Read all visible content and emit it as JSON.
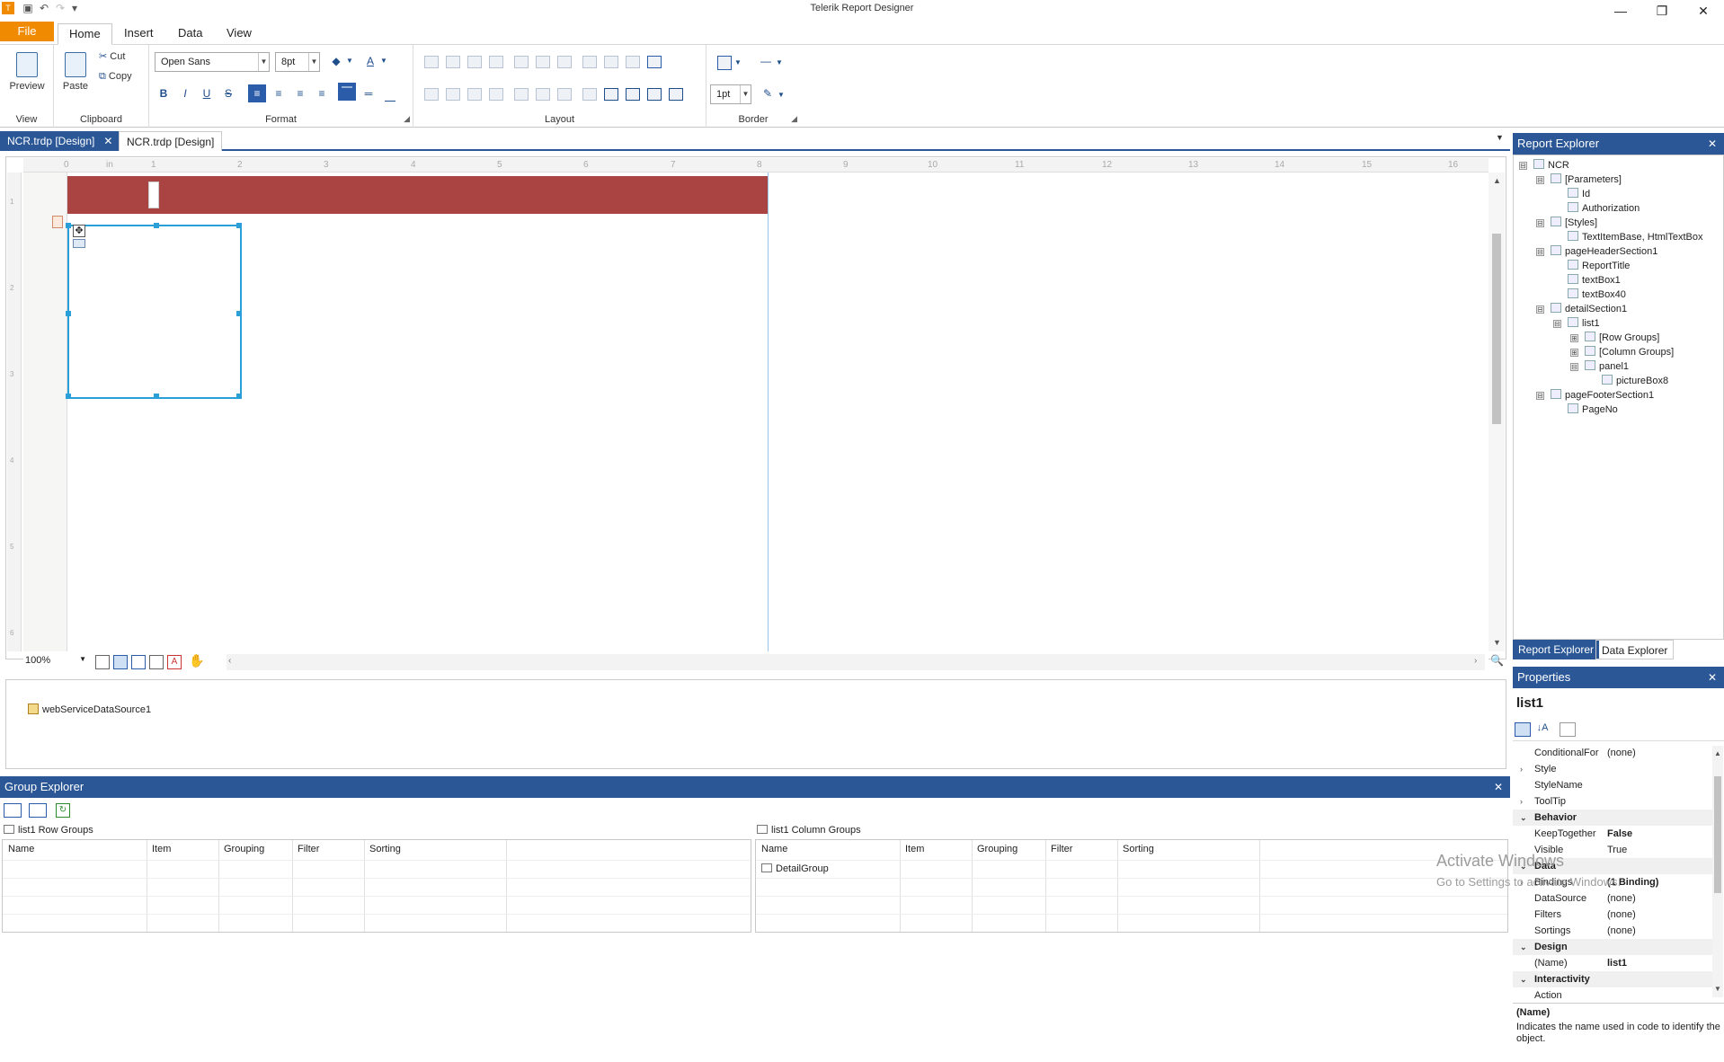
{
  "app": {
    "title": "Telerik Report Designer"
  },
  "window_controls": {
    "minimize": "—",
    "restore": "❐",
    "close": "✕"
  },
  "menu": {
    "file": "File",
    "home": "Home",
    "insert": "Insert",
    "data": "Data",
    "view": "View"
  },
  "ribbon": {
    "view_group": {
      "label": "View",
      "preview": "Preview"
    },
    "clipboard_group": {
      "label": "Clipboard",
      "paste": "Paste",
      "cut": "Cut",
      "copy": "Copy"
    },
    "format_group": {
      "label": "Format",
      "font": "Open Sans",
      "size": "8pt",
      "bold": "B",
      "italic": "I",
      "underline": "U",
      "strike": "S"
    },
    "layout_group": {
      "label": "Layout"
    },
    "border_group": {
      "label": "Border",
      "width": "1pt"
    }
  },
  "doc_tabs": [
    {
      "label": "NCR.trdp [Design]",
      "close": "✕"
    },
    {
      "label": "NCR.trdp [Design]"
    }
  ],
  "ruler": {
    "unit": "in",
    "h_ticks": [
      "0",
      "1",
      "2",
      "3",
      "4",
      "5",
      "6",
      "7",
      "8",
      "9",
      "10",
      "11",
      "12",
      "13",
      "14",
      "15",
      "16"
    ],
    "v_ticks": [
      "1",
      "2",
      "3",
      "4",
      "5",
      "6"
    ]
  },
  "zoom": {
    "value": "100%"
  },
  "datasources": [
    {
      "name": "webServiceDataSource1"
    }
  ],
  "group_explorer": {
    "title": "Group Explorer",
    "close": "✕",
    "row_groups": {
      "title": "list1 Row Groups",
      "columns": [
        "Name",
        "Item",
        "Grouping",
        "Filter",
        "Sorting"
      ],
      "rows": []
    },
    "column_groups": {
      "title": "list1 Column Groups",
      "columns": [
        "Name",
        "Item",
        "Grouping",
        "Filter",
        "Sorting"
      ],
      "rows": [
        {
          "name": "DetailGroup"
        }
      ]
    }
  },
  "report_explorer": {
    "title": "Report Explorer",
    "close": "✕",
    "tree": [
      {
        "label": "NCR",
        "level": 0,
        "expander": "⊟",
        "icon": "report-icon"
      },
      {
        "label": "[Parameters]",
        "level": 1,
        "expander": "⊟",
        "icon": "parameters-icon"
      },
      {
        "label": "Id",
        "level": 2,
        "expander": "",
        "icon": "textbox-icon"
      },
      {
        "label": "Authorization",
        "level": 2,
        "expander": "",
        "icon": "textbox-icon"
      },
      {
        "label": "[Styles]",
        "level": 1,
        "expander": "⊟",
        "icon": "styles-icon"
      },
      {
        "label": "TextItemBase, HtmlTextBox",
        "level": 2,
        "expander": "",
        "icon": "style-icon"
      },
      {
        "label": "pageHeaderSection1",
        "level": 1,
        "expander": "⊟",
        "icon": "section-icon"
      },
      {
        "label": "ReportTitle",
        "level": 2,
        "expander": "",
        "icon": "textbox-icon"
      },
      {
        "label": "textBox1",
        "level": 2,
        "expander": "",
        "icon": "textbox-icon"
      },
      {
        "label": "textBox40",
        "level": 2,
        "expander": "",
        "icon": "textbox-icon"
      },
      {
        "label": "detailSection1",
        "level": 1,
        "expander": "⊟",
        "icon": "section-icon"
      },
      {
        "label": "list1",
        "level": 2,
        "expander": "⊟",
        "icon": "list-icon"
      },
      {
        "label": "[Row Groups]",
        "level": 3,
        "expander": "⊞",
        "icon": "row-groups-icon"
      },
      {
        "label": "[Column Groups]",
        "level": 3,
        "expander": "⊞",
        "icon": "column-groups-icon"
      },
      {
        "label": "panel1",
        "level": 3,
        "expander": "⊟",
        "icon": "panel-icon"
      },
      {
        "label": "pictureBox8",
        "level": 4,
        "expander": "",
        "icon": "picture-icon"
      },
      {
        "label": "pageFooterSection1",
        "level": 1,
        "expander": "⊟",
        "icon": "section-icon"
      },
      {
        "label": "PageNo",
        "level": 2,
        "expander": "",
        "icon": "textbox-icon"
      }
    ],
    "tabs": [
      "Report Explorer",
      "Data Explorer"
    ]
  },
  "properties": {
    "title": "Properties",
    "close": "✕",
    "object_name": "list1",
    "rows": [
      {
        "name": "ConditionalFor",
        "value": "(none)",
        "type": "prop",
        "expander": ""
      },
      {
        "name": "Style",
        "value": "",
        "type": "prop",
        "expander": "›"
      },
      {
        "name": "StyleName",
        "value": "",
        "type": "prop",
        "expander": ""
      },
      {
        "name": "ToolTip",
        "value": "",
        "type": "prop",
        "expander": "›"
      },
      {
        "name": "Behavior",
        "value": "",
        "type": "cat",
        "expander": "⌄"
      },
      {
        "name": "KeepTogether",
        "value": "False",
        "type": "prop",
        "expander": "",
        "bold": true
      },
      {
        "name": "Visible",
        "value": "True",
        "type": "prop",
        "expander": ""
      },
      {
        "name": "Data",
        "value": "",
        "type": "cat",
        "expander": "⌄"
      },
      {
        "name": "Bindings",
        "value": "(1 Binding)",
        "type": "prop",
        "expander": "›",
        "bold": true
      },
      {
        "name": "DataSource",
        "value": "(none)",
        "type": "prop",
        "expander": ""
      },
      {
        "name": "Filters",
        "value": "(none)",
        "type": "prop",
        "expander": ""
      },
      {
        "name": "Sortings",
        "value": "(none)",
        "type": "prop",
        "expander": ""
      },
      {
        "name": "Design",
        "value": "",
        "type": "cat",
        "expander": "⌄"
      },
      {
        "name": "(Name)",
        "value": "list1",
        "type": "prop",
        "expander": "",
        "bold": true
      },
      {
        "name": "Interactivity",
        "value": "",
        "type": "cat",
        "expander": "⌄"
      },
      {
        "name": "Action",
        "value": "",
        "type": "prop",
        "expander": ""
      }
    ],
    "description": {
      "name": "(Name)",
      "text": "Indicates the name used in code to identify the object."
    }
  },
  "watermark": {
    "line1": "Activate Windows",
    "line2": "Go to Settings to activate Windows."
  },
  "colors": {
    "accent": "#2b5797",
    "file_tab": "#f08a00",
    "header_band": "#a94442",
    "selection": "#2a9fd8"
  }
}
